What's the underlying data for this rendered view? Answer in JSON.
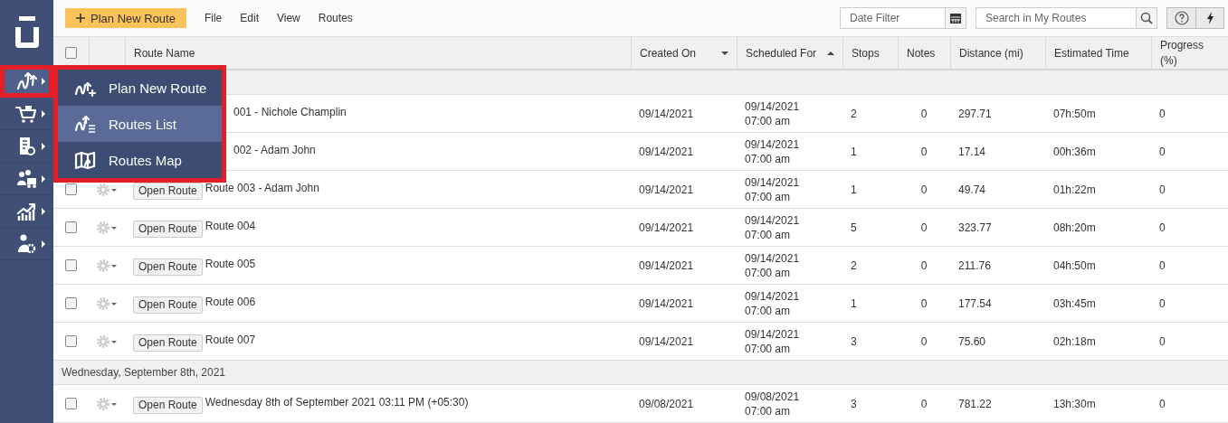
{
  "sidebar": {
    "items": [
      {
        "selected": true
      },
      {
        "selected": false
      },
      {
        "selected": false
      },
      {
        "selected": false
      },
      {
        "selected": false
      },
      {
        "selected": false
      }
    ]
  },
  "toolbar": {
    "primary_button": "Plan New Route",
    "menus": [
      "File",
      "Edit",
      "View",
      "Routes"
    ],
    "date_filter": {
      "placeholder": "Date Filter"
    },
    "search": {
      "placeholder": "Search in My Routes"
    }
  },
  "table": {
    "select_all": {
      "checked": false
    },
    "columns": [
      {
        "label": "Route Name",
        "sorted": false
      },
      {
        "label": "Created On",
        "sorted": true,
        "ascending": false
      },
      {
        "label": "Scheduled For",
        "sorted": true,
        "ascending": true
      },
      {
        "label": "Stops",
        "sorted": false
      },
      {
        "label": "Notes",
        "sorted": false
      },
      {
        "label": "Distance (mi)",
        "sorted": false
      },
      {
        "label": "Estimated Time",
        "sorted": false
      },
      {
        "label": "Progress (%)",
        "sorted": false
      }
    ],
    "groups": [
      {
        "rows": [
          {
            "name": "001 - Nichole Champlin",
            "created_on": "09/14/2021",
            "scheduled_date": "09/14/2021",
            "scheduled_time": "07:00 am",
            "stops": "2",
            "notes": "0",
            "distance": "297.71",
            "estimated_time": "07h:50m",
            "progress": "0"
          },
          {
            "name": "002 - Adam John",
            "created_on": "09/14/2021",
            "scheduled_date": "09/14/2021",
            "scheduled_time": "07:00 am",
            "stops": "1",
            "notes": "0",
            "distance": "17.14",
            "estimated_time": "00h:36m",
            "progress": "0"
          },
          {
            "checked": false,
            "button": "Open Route",
            "name": "Route 003 - Adam John",
            "created_on": "09/14/2021",
            "scheduled_date": "09/14/2021",
            "scheduled_time": "07:00 am",
            "stops": "1",
            "notes": "0",
            "distance": "49.74",
            "estimated_time": "01h:22m",
            "progress": "0"
          },
          {
            "checked": false,
            "button": "Open Route",
            "name": "Route 004",
            "created_on": "09/14/2021",
            "scheduled_date": "09/14/2021",
            "scheduled_time": "07:00 am",
            "stops": "5",
            "notes": "0",
            "distance": "323.77",
            "estimated_time": "08h:20m",
            "progress": "0"
          },
          {
            "checked": false,
            "button": "Open Route",
            "name": "Route 005",
            "created_on": "09/14/2021",
            "scheduled_date": "09/14/2021",
            "scheduled_time": "07:00 am",
            "stops": "2",
            "notes": "0",
            "distance": "211.76",
            "estimated_time": "04h:50m",
            "progress": "0"
          },
          {
            "checked": false,
            "button": "Open Route",
            "name": "Route 006",
            "created_on": "09/14/2021",
            "scheduled_date": "09/14/2021",
            "scheduled_time": "07:00 am",
            "stops": "1",
            "notes": "0",
            "distance": "177.54",
            "estimated_time": "03h:45m",
            "progress": "0"
          },
          {
            "checked": false,
            "button": "Open Route",
            "name": "Route 007",
            "created_on": "09/14/2021",
            "scheduled_date": "09/14/2021",
            "scheduled_time": "07:00 am",
            "stops": "3",
            "notes": "0",
            "distance": "75.60",
            "estimated_time": "02h:18m",
            "progress": "0"
          }
        ]
      },
      {
        "label": "Wednesday, September 8th, 2021",
        "rows": [
          {
            "checked": false,
            "button": "Open Route",
            "name": "Wednesday 8th of September 2021 03:11 PM (+05:30)",
            "created_on": "09/08/2021",
            "scheduled_date": "09/08/2021",
            "scheduled_time": "07:00 am",
            "stops": "3",
            "notes": "0",
            "distance": "781.22",
            "estimated_time": "13h:30m",
            "progress": "0"
          }
        ]
      }
    ]
  },
  "popup_menu": {
    "items": [
      {
        "label": "Plan New Route",
        "selected": false
      },
      {
        "label": "Routes List",
        "selected": true
      },
      {
        "label": "Routes Map",
        "selected": false
      }
    ]
  }
}
